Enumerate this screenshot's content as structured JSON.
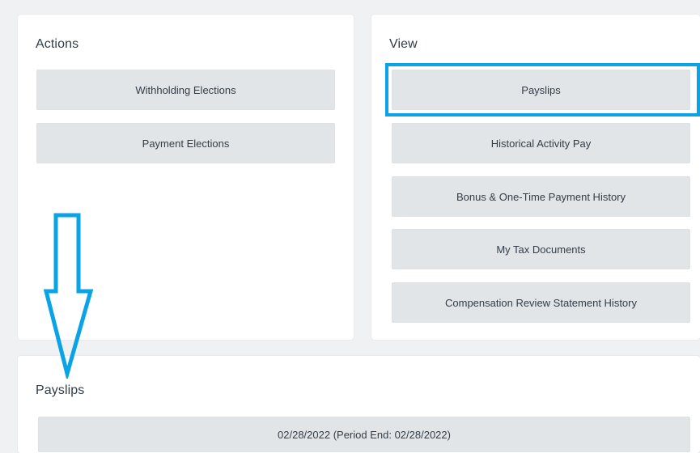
{
  "actions": {
    "title": "Actions",
    "buttons": [
      "Withholding Elections",
      "Payment Elections"
    ]
  },
  "view": {
    "title": "View",
    "buttons": [
      "Payslips",
      "Historical Activity Pay",
      "Bonus & One-Time Payment History",
      "My Tax Documents",
      "Compensation Review Statement History"
    ]
  },
  "payslips": {
    "title": "Payslips",
    "rows": [
      "02/28/2022 (Period End: 02/28/2022)"
    ]
  },
  "annotation": {
    "highlight_color": "#0aa3e6",
    "arrow_icon": "down-arrow-icon"
  },
  "colors": {
    "page_bg": "#f0f1f2",
    "card_bg": "#ffffff",
    "button_bg": "#e1e5e8",
    "text": "#333d47"
  }
}
